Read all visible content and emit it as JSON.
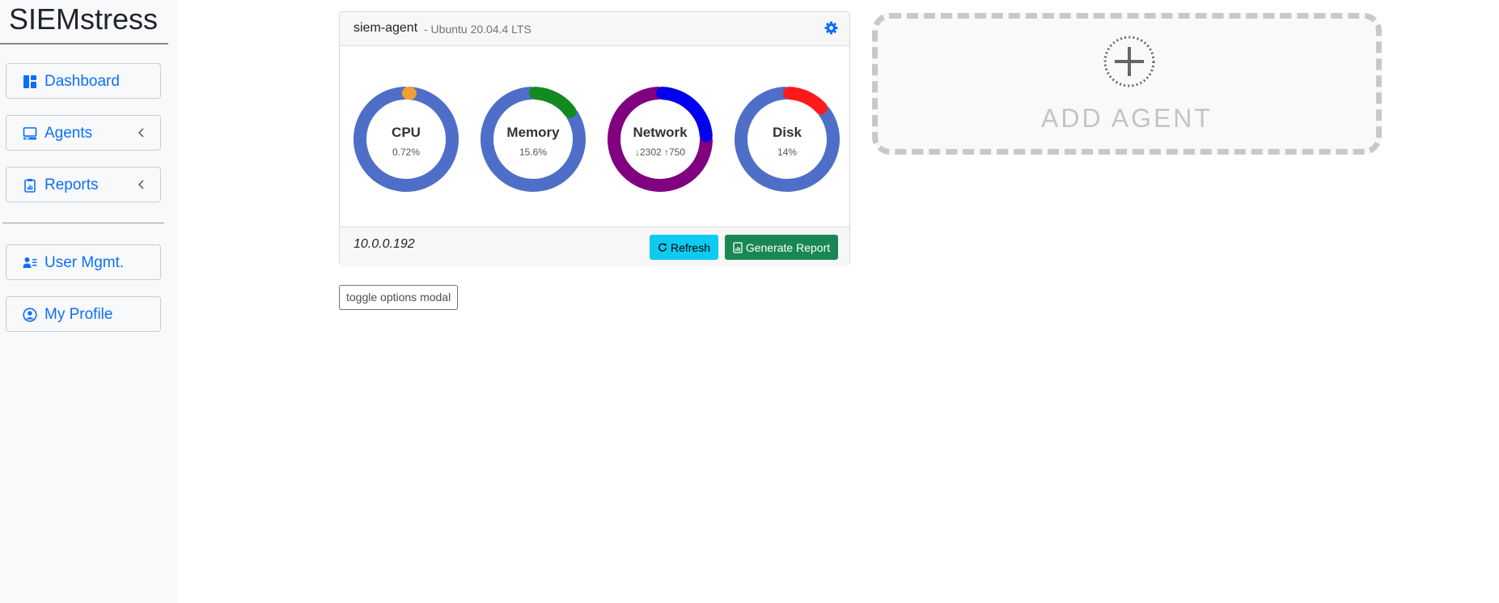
{
  "sidebar": {
    "brand": "SIEMstress",
    "items": [
      {
        "label": "Dashboard",
        "icon": "dashboard-icon"
      },
      {
        "label": "Agents",
        "icon": "monitor-icon",
        "expandable": true
      },
      {
        "label": "Reports",
        "icon": "clipboard-chart-icon",
        "expandable": true
      },
      {
        "label": "User Mgmt.",
        "icon": "users-list-icon"
      },
      {
        "label": "My Profile",
        "icon": "person-circle-icon"
      }
    ]
  },
  "agent_card": {
    "name": "siem-agent",
    "os": "- Ubuntu 20.04.4 LTS",
    "settings_icon": "gear-icon",
    "gauges": [
      {
        "title": "CPU",
        "value": "0.72%",
        "fraction": 0.0072,
        "colors": [
          "#f0a030",
          "#4f6ec7"
        ]
      },
      {
        "title": "Memory",
        "value": "15.6%",
        "fraction": 0.156,
        "colors": [
          "#138a1f",
          "#4f6ec7"
        ]
      },
      {
        "title": "Network",
        "value": "↓2302 ↑750",
        "fraction": 0.2457,
        "colors": [
          "#0000ee",
          "#800080"
        ]
      },
      {
        "title": "Disk",
        "value": "14%",
        "fraction": 0.14,
        "colors": [
          "#ff1a1a",
          "#4f6ec7"
        ]
      }
    ],
    "ip": "10.0.0.192",
    "refresh_label": "Refresh",
    "report_label": "Generate Report"
  },
  "toggle_label": "toggle options modal",
  "add_agent": {
    "label": "ADD AGENT",
    "icon": "plus-circle-icon"
  }
}
